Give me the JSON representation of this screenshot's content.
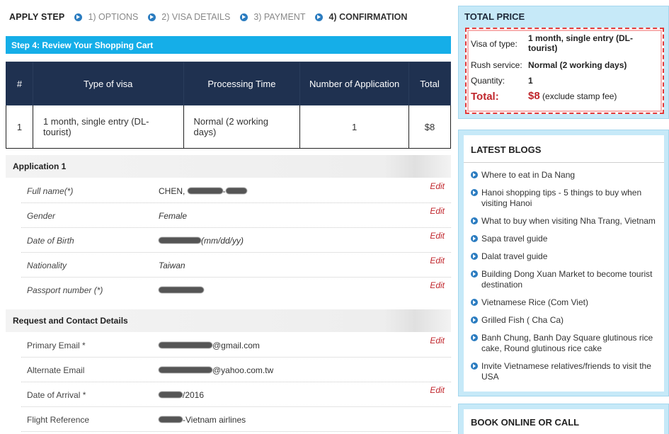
{
  "steps": {
    "apply": "APPLY STEP",
    "items": [
      "1) OPTIONS",
      "2) VISA DETAILS",
      "3) PAYMENT",
      "4) CONFIRMATION"
    ]
  },
  "step_header": "Step 4: Review Your Shopping Cart",
  "cart": {
    "headers": [
      "#",
      "Type of visa",
      "Processing Time",
      "Number of Application",
      "Total"
    ],
    "row": {
      "num": "1",
      "visa": "1 month, single entry (DL-tourist)",
      "processing": "Normal (2 working days)",
      "count": "1",
      "total": "$8"
    }
  },
  "application": {
    "title": "Application 1",
    "edit_label": "Edit",
    "fields": {
      "full_name": {
        "label": "Full name(*)",
        "value": "CHEN, "
      },
      "gender": {
        "label": "Gender",
        "value": "Female"
      },
      "dob": {
        "label": "Date of Birth",
        "value": "(mm/dd/yy)"
      },
      "nationality": {
        "label": "Nationality",
        "value": "Taiwan"
      },
      "passport": {
        "label": "Passport number (*)",
        "value": ""
      }
    }
  },
  "contact": {
    "title": "Request and Contact Details",
    "fields": {
      "primary_email": {
        "label": "Primary Email *",
        "value": "@gmail.com"
      },
      "alternate_email": {
        "label": "Alternate Email",
        "value": "@yahoo.com.tw"
      },
      "arrival": {
        "label": "Date of Arrival *",
        "value": "/2016"
      },
      "flight": {
        "label": "Flight Reference",
        "value": "-Vietnam airlines"
      }
    }
  },
  "total_price": {
    "title": "TOTAL PRICE",
    "visa_label": "Visa of type:",
    "visa_value": "1 month, single entry (DL-tourist)",
    "rush_label": "Rush service:",
    "rush_value": "Normal (2 working days)",
    "qty_label": "Quantity:",
    "qty_value": "1",
    "total_label": "Total:",
    "total_value": "$8",
    "total_note": "(exclude stamp fee)"
  },
  "blogs": {
    "title": "LATEST BLOGS",
    "items": [
      "Where to eat in Da Nang",
      "Hanoi shopping tips - 5 things to buy when visiting Hanoi",
      "What to buy when visiting Nha Trang, Vietnam",
      "Sapa travel guide",
      "Dalat travel guide",
      "Building Dong Xuan Market to become tourist destination",
      "Vietnamese Rice (Com Viet)",
      "Grilled Fish ( Cha Ca)",
      "Banh Chung, Banh Day Square glutinous rice cake, Round glutinous rice cake",
      "Invite Vietnamese relatives/friends to visit the USA"
    ]
  },
  "book": {
    "title": "BOOK ONLINE OR CALL"
  },
  "colors": {
    "accent": "#15aee8",
    "header_dark": "#1f3150",
    "edit_red": "#c0272d",
    "sidebar_bg": "#c6e9f8"
  }
}
